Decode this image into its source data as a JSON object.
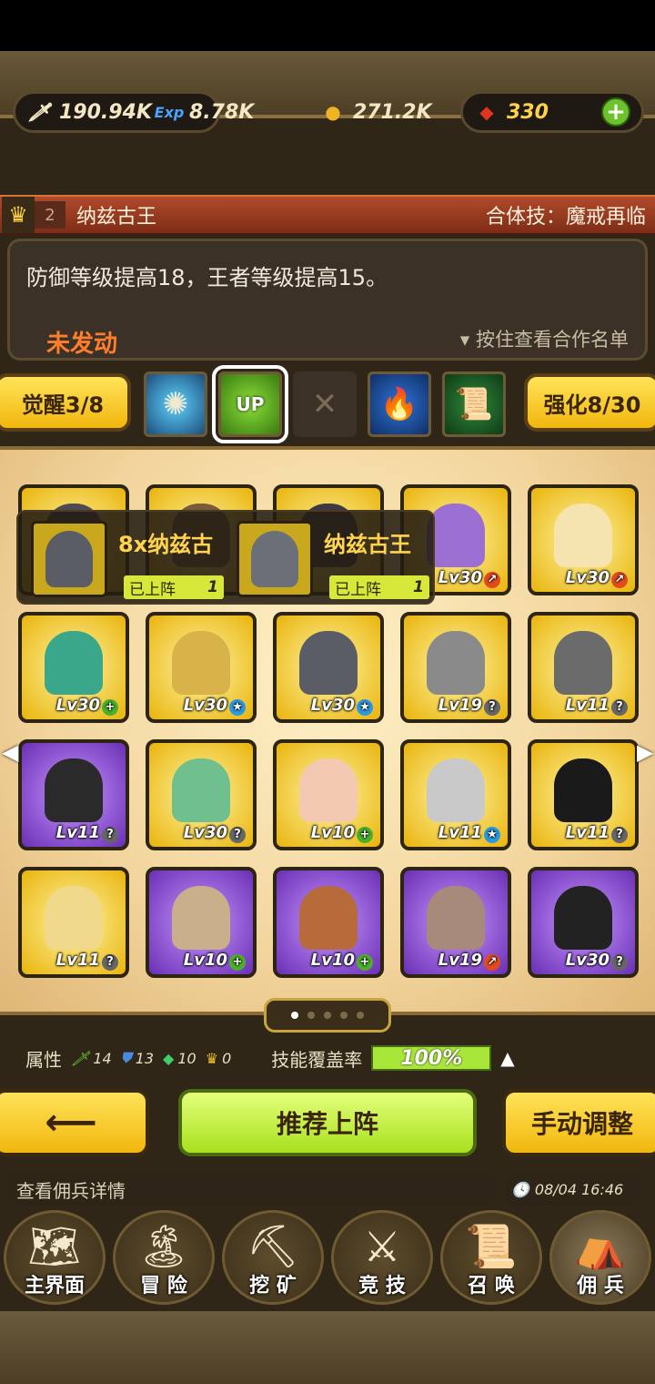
{
  "resources": {
    "attack": "190.94K",
    "exp_label": "Exp",
    "exp": "8.78K",
    "gold": "271.2K",
    "gems": "330"
  },
  "banner": {
    "level": "2",
    "name": "纳兹古王",
    "combo": "合体技：魔戒再临"
  },
  "description": {
    "text": "防御等级提高18，王者等级提高15。",
    "status": "未发动",
    "hint": "按住查看合作名单"
  },
  "skills": {
    "awaken": "觉醒3/8",
    "enhance": "强化8/30",
    "up_label": "UP"
  },
  "tooltip": {
    "left_name": "8x纳兹古",
    "left_tag": "已上阵",
    "left_count": "1",
    "right_name": "纳兹古王",
    "right_tag": "已上阵",
    "right_count": "1"
  },
  "cards": [
    {
      "lv": "",
      "badge": "",
      "color": "gold"
    },
    {
      "lv": "",
      "badge": "",
      "color": "gold"
    },
    {
      "lv": "",
      "badge": "",
      "color": "gold"
    },
    {
      "lv": "Lv30",
      "badge": "red",
      "color": "gold"
    },
    {
      "lv": "Lv30",
      "badge": "red",
      "color": "gold"
    },
    {
      "lv": "Lv30",
      "badge": "green",
      "color": "gold"
    },
    {
      "lv": "Lv30",
      "badge": "blue",
      "color": "gold"
    },
    {
      "lv": "Lv30",
      "badge": "blue",
      "color": "gold"
    },
    {
      "lv": "Lv19",
      "badge": "gray",
      "color": "gold"
    },
    {
      "lv": "Lv11",
      "badge": "gray",
      "color": "gold"
    },
    {
      "lv": "Lv11",
      "badge": "gray",
      "color": "purple"
    },
    {
      "lv": "Lv30",
      "badge": "gray",
      "color": "gold"
    },
    {
      "lv": "Lv10",
      "badge": "green",
      "color": "gold"
    },
    {
      "lv": "Lv11",
      "badge": "blue",
      "color": "gold"
    },
    {
      "lv": "Lv11",
      "badge": "gray",
      "color": "gold"
    },
    {
      "lv": "Lv11",
      "badge": "gray",
      "color": "gold"
    },
    {
      "lv": "Lv10",
      "badge": "green",
      "color": "purple"
    },
    {
      "lv": "Lv10",
      "badge": "green",
      "color": "purple"
    },
    {
      "lv": "Lv19",
      "badge": "red",
      "color": "purple"
    },
    {
      "lv": "Lv30",
      "badge": "gray",
      "color": "purple"
    }
  ],
  "attributes": {
    "label": "属性",
    "sword": "14",
    "shield": "13",
    "gem": "10",
    "crown": "0",
    "coverage_label": "技能覆盖率",
    "coverage": "100%"
  },
  "buttons": {
    "back": "⟵",
    "recommend": "推荐上阵",
    "manual": "手动调整"
  },
  "footer": {
    "info": "查看佣兵详情",
    "time": "08/04 16:46"
  },
  "nav": [
    {
      "label": "主界面",
      "icon": "map-icon"
    },
    {
      "label": "冒 险",
      "icon": "island-icon"
    },
    {
      "label": "挖 矿",
      "icon": "pickaxe-icon"
    },
    {
      "label": "竞 技",
      "icon": "swords-icon"
    },
    {
      "label": "召 唤",
      "icon": "scroll-icon"
    },
    {
      "label": "佣 兵",
      "icon": "tent-icon"
    }
  ]
}
